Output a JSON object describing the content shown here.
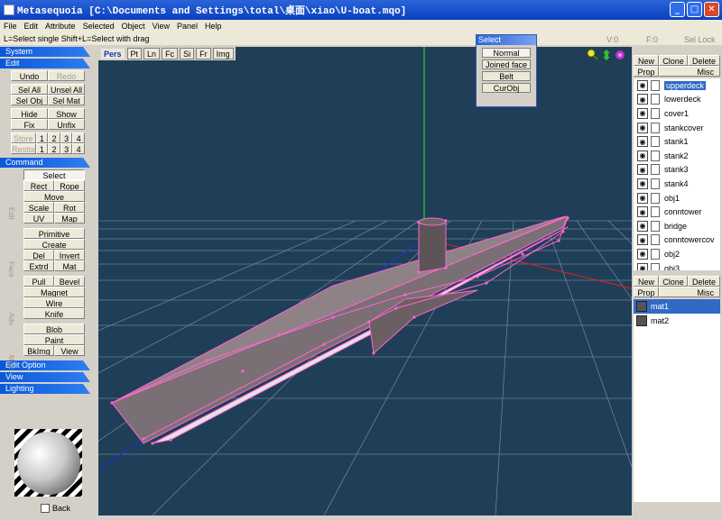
{
  "window": {
    "title": "Metasequoia [C:\\Documents and Settings\\total\\桌面\\xiao\\U-boat.mqo]",
    "btn_min": "_",
    "btn_max": "□",
    "btn_close": "✕"
  },
  "menu": [
    "File",
    "Edit",
    "Attribute",
    "Selected",
    "Object",
    "View",
    "Panel",
    "Help"
  ],
  "status": {
    "hint": "L=Select single  Shift+L=Select with drag",
    "vertices": "V:0",
    "faces": "F:0",
    "sel_lock": "Sel Lock"
  },
  "left": {
    "system": "System",
    "edit": "Edit",
    "undo": "Undo",
    "redo": "Redo",
    "sel_all": "Sel All",
    "unsel_all": "Unsel All",
    "sel_obj": "Sel Obj",
    "sel_mat": "Sel Mat",
    "hide": "Hide",
    "show": "Show",
    "fix": "Fix",
    "unfix": "Unfix",
    "store": "Store",
    "restore": "Restore",
    "slots": [
      "1",
      "2",
      "3",
      "4"
    ],
    "command": "Command",
    "cmd_edit": "Edit",
    "select": "Select",
    "rect": "Rect",
    "rope": "Rope",
    "move": "Move",
    "scale": "Scale",
    "rot": "Rot",
    "uv": "UV",
    "map": "Map",
    "cmd_face": "Face",
    "primitive": "Primitive",
    "create": "Create",
    "del": "Del",
    "invert": "Invert",
    "extrd": "Extrd",
    "mat": "Mat",
    "cmd_adv": "Adv.",
    "pull": "Pull",
    "bevel": "Bevel",
    "magnet": "Magnet",
    "wire": "Wire",
    "knife": "Knife",
    "cmd_misc": "Misc.",
    "blob": "Blob",
    "paint": "Paint",
    "bkimg": "BkImg",
    "view": "View",
    "edit_option": "Edit Option",
    "view_sect": "View",
    "lighting": "Lighting",
    "back": "Back"
  },
  "viewport": {
    "tabs": [
      "Pers",
      "Pt",
      "Ln",
      "Fc",
      "Si",
      "Fr",
      "Img"
    ]
  },
  "select_popup": {
    "title": "Select",
    "options": [
      "Normal",
      "Joined face",
      "Belt",
      "CurObj"
    ]
  },
  "right": {
    "new": "New",
    "clone": "Clone",
    "delete": "Delete",
    "prop": "Prop",
    "misc": "Misc",
    "objects": [
      "upperdeck",
      "lowerdeck",
      "cover1",
      "stankcover",
      "stank1",
      "stank2",
      "stank3",
      "stank4",
      "obj1",
      "conntower",
      "bridge",
      "conntowercov",
      "obj2",
      "obj3"
    ],
    "materials": [
      "mat1",
      "mat2"
    ]
  },
  "colors": {
    "viewport_bg": "#1f3e58",
    "grid": "#8a97a3",
    "edge": "#ff66cc",
    "selection": "#316ac5"
  }
}
